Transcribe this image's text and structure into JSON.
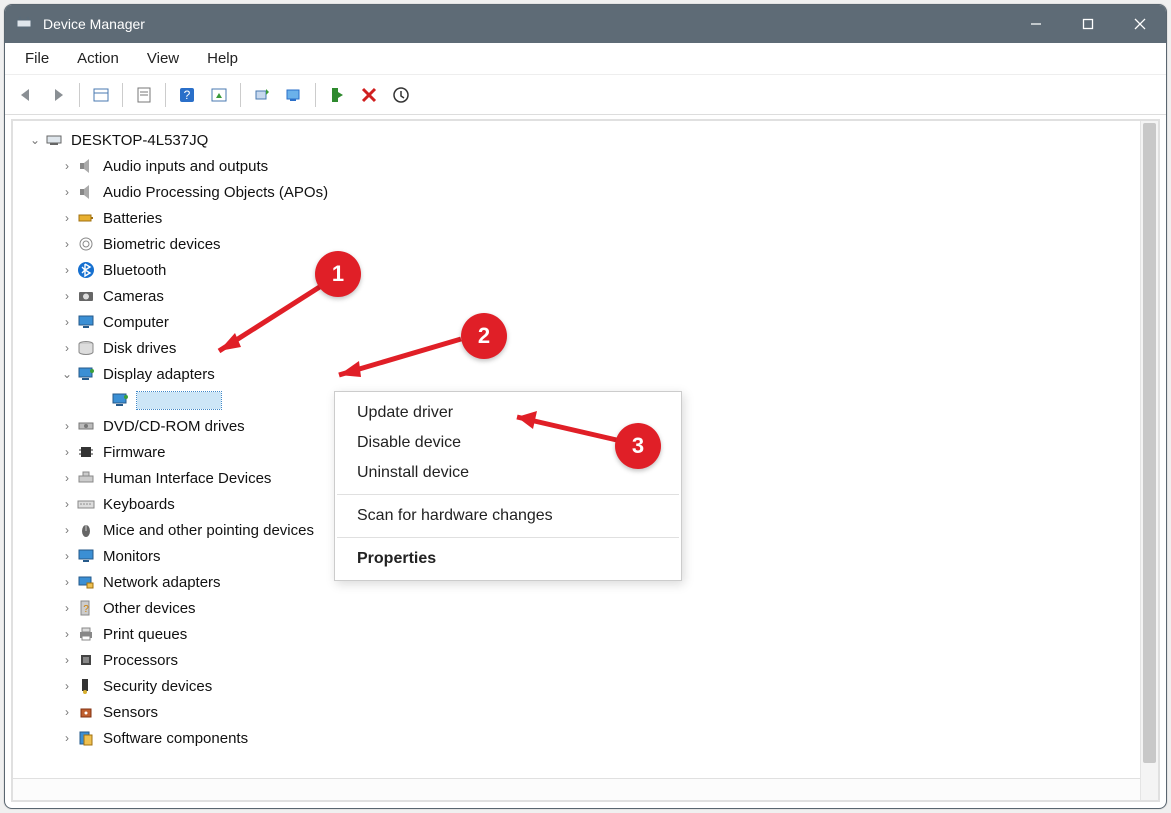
{
  "title": "Device Manager",
  "menubar": [
    "File",
    "Action",
    "View",
    "Help"
  ],
  "toolbar_icons": [
    "back-arrow-icon",
    "forward-arrow-icon",
    "show-hidden-icon",
    "properties-sheet-icon",
    "help-icon",
    "action-icon",
    "scan-hardware-icon",
    "update-driver-tb-icon",
    "enable-device-icon",
    "disable-x-icon",
    "uninstall-icon"
  ],
  "root": {
    "name": "DESKTOP-4L537JQ",
    "expanded": true
  },
  "categories": [
    {
      "label": "Audio inputs and outputs",
      "icon": "speaker-icon",
      "expandable": true
    },
    {
      "label": "Audio Processing Objects (APOs)",
      "icon": "speaker-icon",
      "expandable": true
    },
    {
      "label": "Batteries",
      "icon": "battery-icon",
      "expandable": true
    },
    {
      "label": "Biometric devices",
      "icon": "fingerprint-icon",
      "expandable": true
    },
    {
      "label": "Bluetooth",
      "icon": "bluetooth-icon",
      "expandable": true
    },
    {
      "label": "Cameras",
      "icon": "camera-icon",
      "expandable": true
    },
    {
      "label": "Computer",
      "icon": "monitor-icon",
      "expandable": true
    },
    {
      "label": "Disk drives",
      "icon": "disk-icon",
      "expandable": true
    },
    {
      "label": "Display adapters",
      "icon": "display-adapter-icon",
      "expandable": true,
      "expanded": true,
      "children": [
        {
          "label": "",
          "icon": "display-adapter-icon",
          "selected": true
        }
      ]
    },
    {
      "label": "DVD/CD-ROM drives",
      "icon": "optical-drive-icon",
      "expandable": true
    },
    {
      "label": "Firmware",
      "icon": "chip-icon",
      "expandable": true
    },
    {
      "label": "Human Interface Devices",
      "icon": "hid-icon",
      "expandable": true
    },
    {
      "label": "Keyboards",
      "icon": "keyboard-icon",
      "expandable": true
    },
    {
      "label": "Mice and other pointing devices",
      "icon": "mouse-icon",
      "expandable": true
    },
    {
      "label": "Monitors",
      "icon": "monitor-icon",
      "expandable": true
    },
    {
      "label": "Network adapters",
      "icon": "network-icon",
      "expandable": true
    },
    {
      "label": "Other devices",
      "icon": "unknown-device-icon",
      "expandable": true
    },
    {
      "label": "Print queues",
      "icon": "printer-icon",
      "expandable": true
    },
    {
      "label": "Processors",
      "icon": "cpu-icon",
      "expandable": true
    },
    {
      "label": "Security devices",
      "icon": "security-icon",
      "expandable": true
    },
    {
      "label": "Sensors",
      "icon": "sensor-icon",
      "expandable": true
    },
    {
      "label": "Software components",
      "icon": "software-icon",
      "expandable": true
    }
  ],
  "context_menu": {
    "items": [
      {
        "label": "Update driver",
        "kind": "item"
      },
      {
        "label": "Disable device",
        "kind": "item"
      },
      {
        "label": "Uninstall device",
        "kind": "item"
      },
      {
        "kind": "sep"
      },
      {
        "label": "Scan for hardware changes",
        "kind": "item"
      },
      {
        "kind": "sep"
      },
      {
        "label": "Properties",
        "kind": "item",
        "bold": true
      }
    ]
  },
  "annotations": [
    "1",
    "2",
    "3"
  ],
  "colors": {
    "accent": "#e01f27",
    "selection": "#cde6f7",
    "titlebar": "#5e6b76"
  }
}
